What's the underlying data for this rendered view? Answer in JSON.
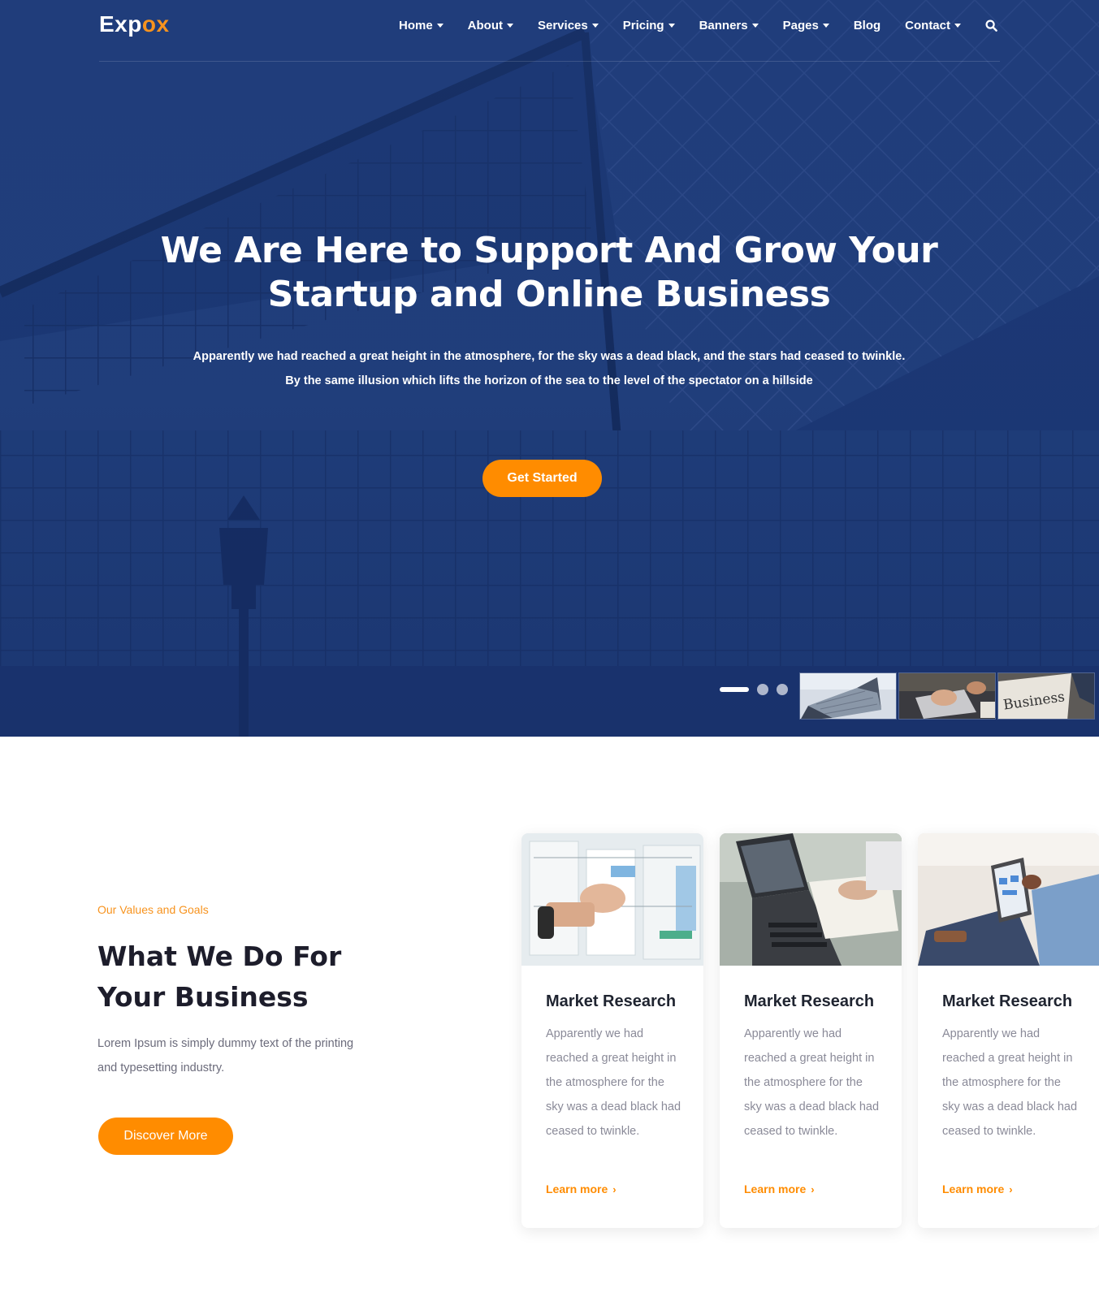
{
  "colors": {
    "hero_blue": "#1e3a78",
    "accent_orange": "#ff8c00",
    "logo_accent": "#f7931e",
    "heading_dark": "#1d1d2b",
    "body_gray": "#8a8a98"
  },
  "nav": {
    "logo_main": "Exp",
    "logo_accent": "ox",
    "items": [
      {
        "label": "Home",
        "dropdown": true
      },
      {
        "label": "About",
        "dropdown": true
      },
      {
        "label": "Services",
        "dropdown": true
      },
      {
        "label": "Pricing",
        "dropdown": true
      },
      {
        "label": "Banners",
        "dropdown": true
      },
      {
        "label": "Pages",
        "dropdown": true
      },
      {
        "label": "Blog",
        "dropdown": false
      },
      {
        "label": "Contact",
        "dropdown": true
      }
    ],
    "search_icon": "search-icon"
  },
  "hero": {
    "title_line1": "We Are Here to Support And Grow Your",
    "title_line2": "Startup and Online Business",
    "subtitle_line1": "Apparently we had reached a great height in the atmosphere, for the sky was a dead black, and the stars had ceased to twinkle.",
    "subtitle_line2": "By the same illusion which lifts the horizon of the sea to the level of the spectator on a hillside",
    "cta_label": "Get Started",
    "slider": {
      "active_index": 0,
      "count": 3
    },
    "thumbnail_text": "Business"
  },
  "services": {
    "eyebrow": "Our Values and Goals",
    "title_line1": "What We Do For",
    "title_line2": "Your Business",
    "description": "Lorem Ipsum is simply dummy text of the printing and typesetting industry.",
    "button_label": "Discover More",
    "cards": [
      {
        "title": "Market Research",
        "text": "Apparently we had reached a great height in the atmosphere for the sky was a dead black had ceased to twinkle.",
        "link": "Learn more"
      },
      {
        "title": "Market Research",
        "text": "Apparently we had reached a great height in the atmosphere for the sky was a dead black had ceased to twinkle.",
        "link": "Learn more"
      },
      {
        "title": "Market Research",
        "text": "Apparently we had reached a great height in the atmosphere for the sky was a dead black had ceased to twinkle.",
        "link": "Learn more"
      }
    ]
  }
}
